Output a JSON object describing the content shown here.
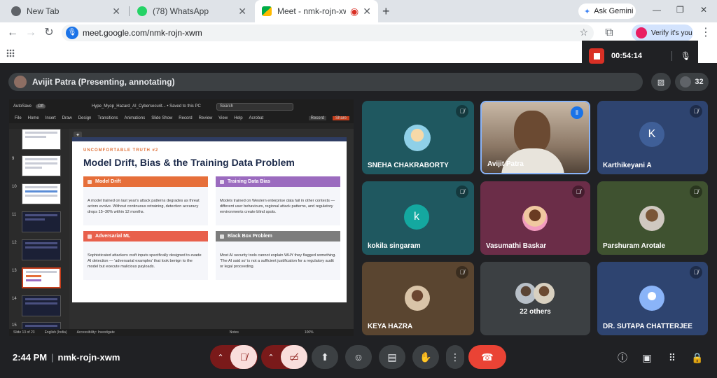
{
  "browser": {
    "tabs": [
      {
        "title": "New Tab",
        "icon": "chrome-icon"
      },
      {
        "title": "(78) WhatsApp",
        "icon": "whatsapp-icon"
      },
      {
        "title": "Meet - nmk-rojn-xwm",
        "icon": "meet-icon",
        "active": true
      }
    ],
    "new_tab": "+",
    "ask_gemini": "Ask Gemini",
    "url": "meet.google.com/nmk-rojn-xwm",
    "verify_label": "Verify it's you"
  },
  "recording": {
    "time": "00:54:14"
  },
  "presenter": {
    "label": "Avijit Patra (Presenting, annotating)"
  },
  "participant_count": "32",
  "ppt": {
    "autosave": "AutoSave",
    "toggle": "Off",
    "filename": "Hype_Myop_Hazard_AI_Cybersecurit... • Saved to this PC",
    "search": "Search",
    "menu": [
      "File",
      "Home",
      "Insert",
      "Draw",
      "Design",
      "Transitions",
      "Animations",
      "Slide Show",
      "Record",
      "Review",
      "View",
      "Help",
      "Acrobat"
    ],
    "record": "Record",
    "share": "Share",
    "thumb_numbers": [
      "9",
      "10",
      "11",
      "12",
      "13",
      "14",
      "15"
    ],
    "status": {
      "slide": "Slide 13 of 23",
      "lang": "English (India)",
      "access": "Accessibility: Investigate",
      "notes": "Notes",
      "zoom": "100%"
    }
  },
  "slide": {
    "kicker": "UNCOMFORTABLE TRUTH #2",
    "title": "Model Drift, Bias & the Training Data Problem",
    "cards": [
      {
        "title": "Model Drift",
        "color": "#e66f3a",
        "body": "A model trained on last year's attack patterns degrades as threat actors evolve. Without continuous retraining, detection accuracy drops 15–30% within 12 months."
      },
      {
        "title": "Training Data Bias",
        "color": "#9b6bbf",
        "body": "Models trained on Western enterprise data fail in other contexts — different user behaviours, regional attack patterns, and regulatory environments create blind spots."
      },
      {
        "title": "Adversarial ML",
        "color": "#e8604c",
        "body": "Sophisticated attackers craft inputs specifically designed to evade AI detection — 'adversarial examples' that look benign to the model but execute malicious payloads."
      },
      {
        "title": "Black Box Problem",
        "color": "#7d7d7d",
        "body": "Most AI security tools cannot explain WHY they flagged something. 'The AI said so' is not a sufficient justification for a regulatory audit or legal proceeding."
      }
    ]
  },
  "participants": [
    {
      "name": "SNEHA CHAKRABORTY",
      "bg": "#1f5860",
      "kind": "photo",
      "muted": true
    },
    {
      "name": "Avijit Patra",
      "bg": "#6b5a4b",
      "kind": "video",
      "speaking": true
    },
    {
      "name": "Karthikeyani A",
      "bg": "#2e4470",
      "kind": "letter",
      "letter": "K",
      "avatar_color": "#3f5f98",
      "muted": true
    },
    {
      "name": "kokila singaram",
      "bg": "#1f5860",
      "kind": "letter",
      "letter": "k",
      "avatar_color": "#14a8a0",
      "muted": true
    },
    {
      "name": "Vasumathi Baskar",
      "bg": "#6b2d48",
      "kind": "photo",
      "muted": true
    },
    {
      "name": "Parshuram Arotale",
      "bg": "#3f5230",
      "kind": "photo",
      "muted": true
    },
    {
      "name": "KEYA HAZRA",
      "bg": "#5a4530",
      "kind": "photo",
      "muted": true
    },
    {
      "name": "22 others",
      "bg": "#3c4043",
      "kind": "group"
    },
    {
      "name": "DR. SUTAPA CHATTERJEE",
      "bg": "#2e4470",
      "kind": "generic",
      "muted": true
    }
  ],
  "meeting": {
    "time": "2:44 PM",
    "code": "nmk-rojn-xwm"
  }
}
